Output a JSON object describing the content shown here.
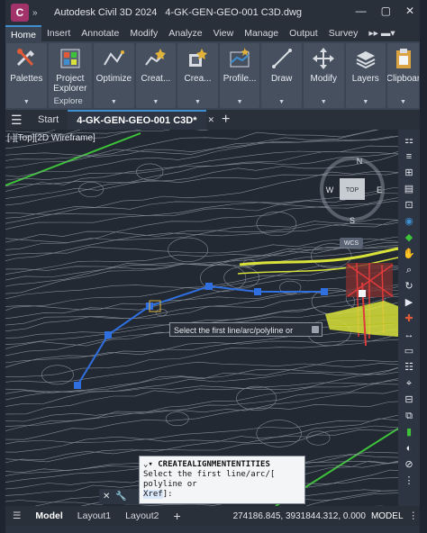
{
  "app": {
    "logo_letter": "C",
    "title": "Autodesk Civil 3D 2024",
    "document": "4-GK-GEN-GEO-001 C3D.dwg"
  },
  "ribbon_tabs": [
    "Home",
    "Insert",
    "Annotate",
    "Modify",
    "Analyze",
    "View",
    "Manage",
    "Output",
    "Survey"
  ],
  "ribbon_buttons": [
    {
      "label": "Palettes",
      "icon": "tools-icon"
    },
    {
      "label": "Project\nExplorer",
      "icon": "project-explorer-icon"
    },
    {
      "label": "Optimize",
      "icon": "optimize-icon"
    },
    {
      "label": "Creat...",
      "icon": "create-icon"
    },
    {
      "label": "Crea...",
      "icon": "create-design-icon"
    },
    {
      "label": "Profile...",
      "icon": "profile-icon"
    },
    {
      "label": "Draw",
      "icon": "draw-icon"
    },
    {
      "label": "Modify",
      "icon": "move-icon"
    },
    {
      "label": "Layers",
      "icon": "layers-icon"
    },
    {
      "label": "Clipboar",
      "icon": "clipboard-icon"
    }
  ],
  "ribbon_panel_name": "Explore",
  "file_tabs": {
    "start": "Start",
    "active": "4-GK-GEN-GEO-001 C3D*"
  },
  "viewport_label": "[-][Top][2D Wireframe]",
  "viewcube": {
    "top": "TOP",
    "north": "N",
    "west": "W",
    "east": "E",
    "south": "S",
    "wcs": "WCS"
  },
  "tooltip": "Select the first line/arc/polyline or",
  "command": {
    "header": "CREATEALIGNMENTENTITIES",
    "line1": "Select the first line/arc/",
    "line2": "polyline or",
    "option": "Xref",
    "suffix": "]:",
    "bracket": "["
  },
  "status": {
    "model_tab": "Model",
    "layouts": [
      "Layout1",
      "Layout2"
    ],
    "coordinates": "274186.845, 3931844.312, 0.000",
    "space": "MODEL"
  },
  "colors": {
    "accent": "#3e8ed0",
    "alignment": "#2f6fe0",
    "contours": "#9aa2ad",
    "green": "#3ec23a",
    "yellow": "#d8e23a"
  }
}
